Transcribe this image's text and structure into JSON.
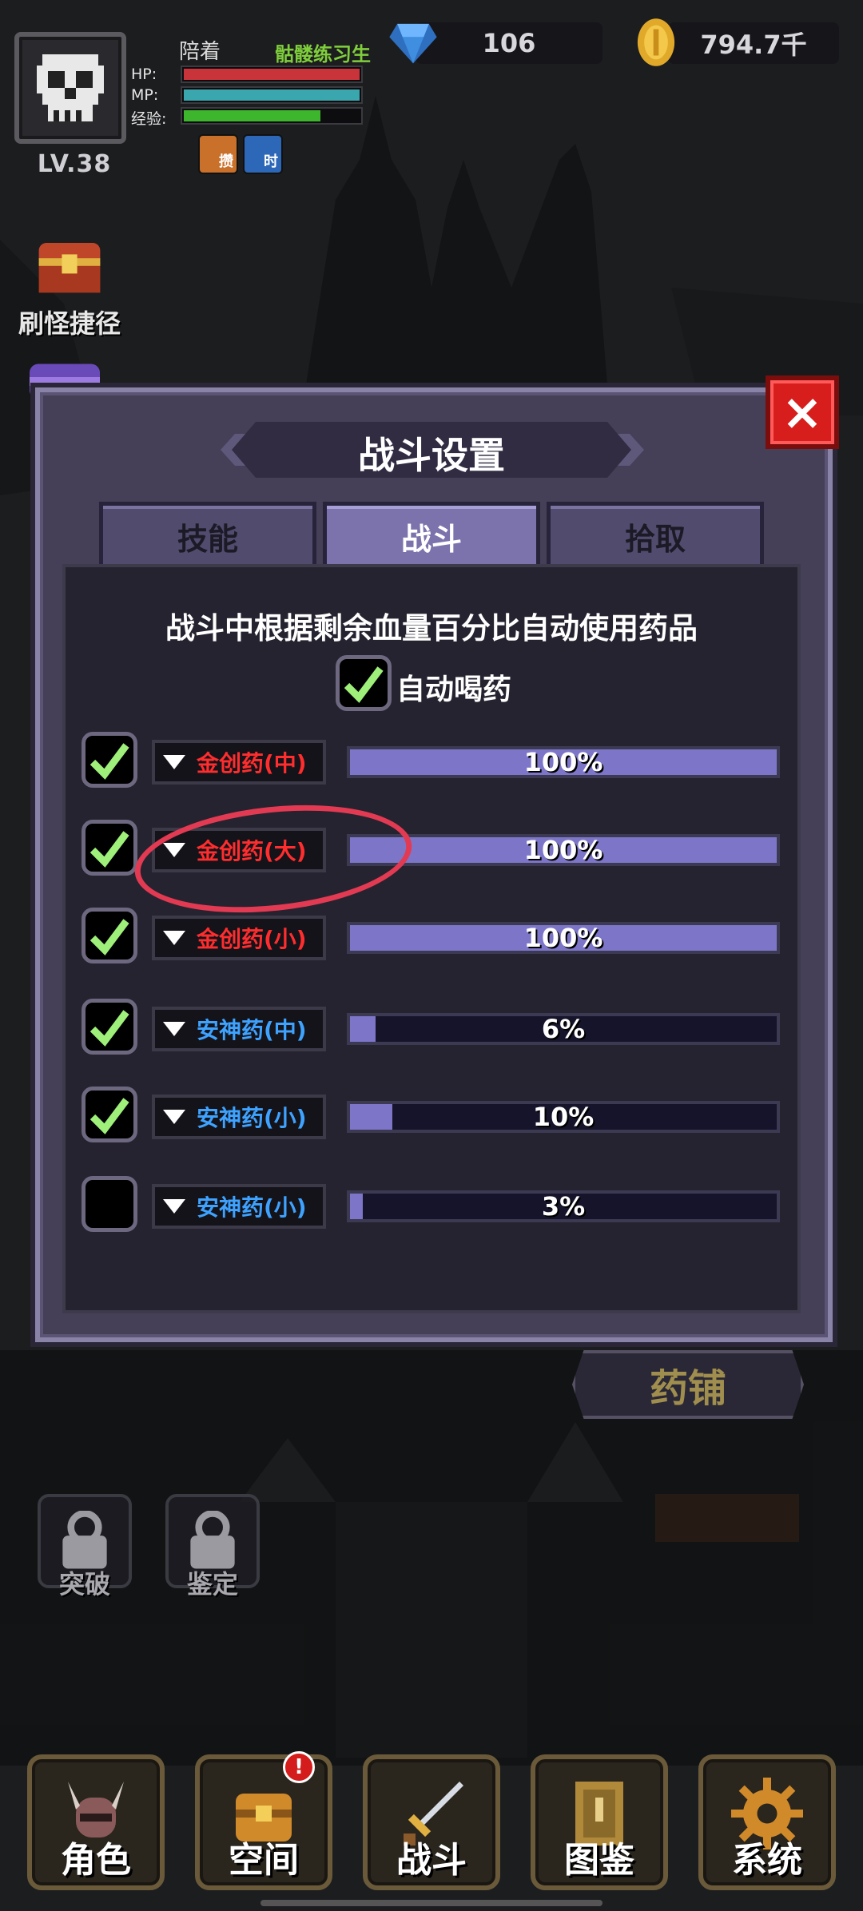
{
  "player": {
    "name": "陪着",
    "title": "骷髅练习生",
    "level": "LV.38",
    "stats": [
      {
        "label": "HP:",
        "fill": 1.0,
        "color": "#c8343a"
      },
      {
        "label": "MP:",
        "fill": 1.0,
        "color": "#3aa6ad"
      },
      {
        "label": "经验:",
        "fill": 0.78,
        "color": "#3db52c"
      }
    ],
    "buffs": [
      {
        "label": "攒",
        "icon": "fist-buff-icon",
        "color": "#c9702a"
      },
      {
        "label": "时",
        "icon": "clock-buff-icon",
        "color": "#2d67b8"
      }
    ]
  },
  "currency": {
    "gems": "106",
    "gold": "794.7千"
  },
  "side_shortcuts": [
    {
      "label": "刷怪捷径",
      "icon": "treasure-chest-icon"
    }
  ],
  "dialog": {
    "title": "战斗设置",
    "close_label": "×",
    "tabs": [
      {
        "label": "技能",
        "active": false
      },
      {
        "label": "战斗",
        "active": true
      },
      {
        "label": "拾取",
        "active": false
      }
    ],
    "description": "战斗中根据剩余血量百分比自动使用药品",
    "auto_drink": {
      "label": "自动喝药",
      "checked": true
    },
    "potions": [
      {
        "name": "金创药(中)",
        "color": "#ff2d2d",
        "percent": "100%",
        "value": 1.0,
        "checked": true
      },
      {
        "name": "金创药(大)",
        "color": "#ff2d2d",
        "percent": "100%",
        "value": 1.0,
        "checked": true
      },
      {
        "name": "金创药(小)",
        "color": "#ff2d2d",
        "percent": "100%",
        "value": 1.0,
        "checked": true
      },
      {
        "name": "安神药(中)",
        "color": "#3ea2ff",
        "percent": "6%",
        "value": 0.06,
        "checked": true
      },
      {
        "name": "安神药(小)",
        "color": "#3ea2ff",
        "percent": "10%",
        "value": 0.1,
        "checked": true
      },
      {
        "name": "安神药(小)",
        "color": "#3ea2ff",
        "percent": "3%",
        "value": 0.03,
        "checked": false
      }
    ]
  },
  "shop_button": "药铺",
  "locked_slots": [
    {
      "label": "突破"
    },
    {
      "label": "鉴定"
    }
  ],
  "bottom_nav": [
    {
      "label": "角色",
      "icon": "character-helmet-icon"
    },
    {
      "label": "空间",
      "icon": "storage-chest-icon"
    },
    {
      "label": "战斗",
      "icon": "sword-icon"
    },
    {
      "label": "图鉴",
      "icon": "book-icon"
    },
    {
      "label": "系统",
      "icon": "gear-icon"
    }
  ],
  "notification_badge": "!"
}
